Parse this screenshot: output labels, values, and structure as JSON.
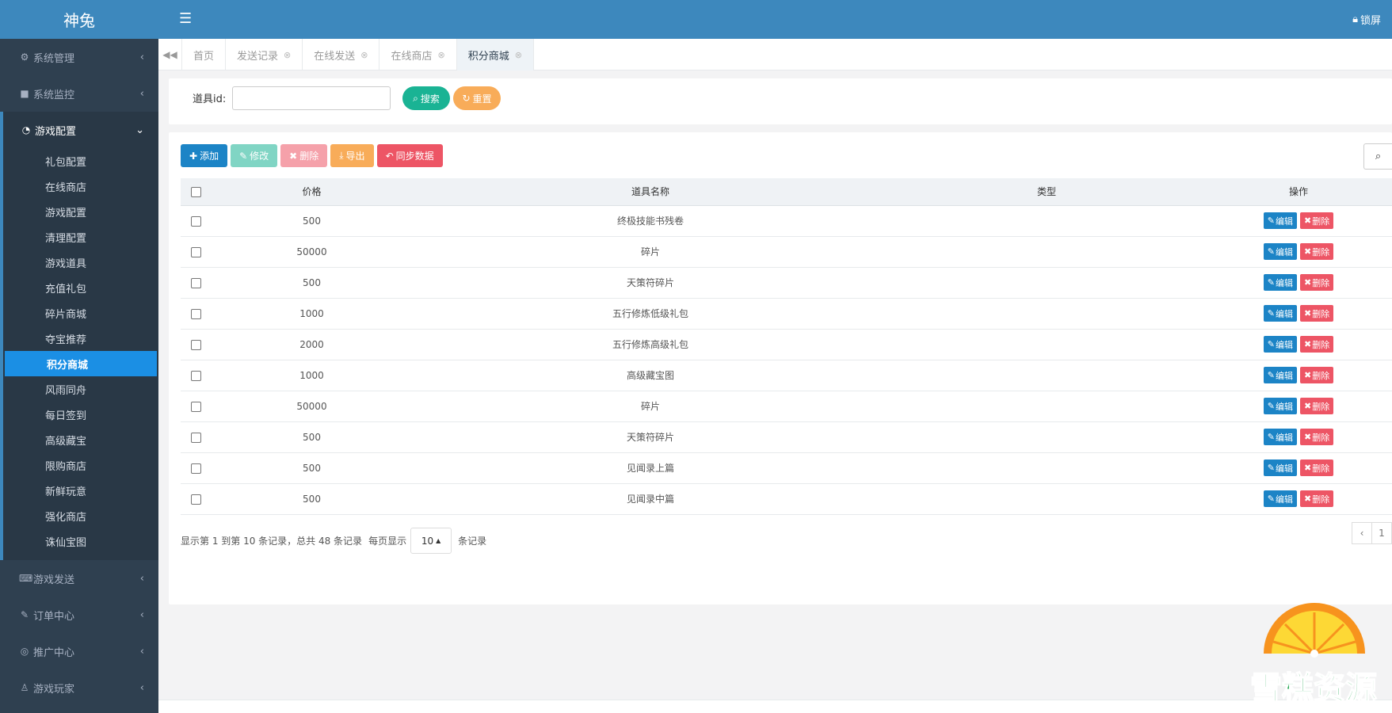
{
  "brand": "神兔",
  "topbar": {
    "lock_label": "锁屏"
  },
  "sidebar": {
    "items_top": [
      {
        "label": "系统管理"
      },
      {
        "label": "系统监控"
      }
    ],
    "group": {
      "label": "游戏配置",
      "children": [
        "礼包配置",
        "在线商店",
        "游戏配置",
        "清理配置",
        "游戏道具",
        "充值礼包",
        "碎片商城",
        "夺宝推荐",
        "积分商城",
        "风雨同舟",
        "每日签到",
        "高级藏宝",
        "限购商店",
        "新鲜玩意",
        "强化商店",
        "诛仙宝图"
      ],
      "active_index": 8
    },
    "items_bottom": [
      {
        "label": "游戏发送"
      },
      {
        "label": "订单中心"
      },
      {
        "label": "推广中心"
      },
      {
        "label": "游戏玩家"
      }
    ]
  },
  "tabs": [
    {
      "label": "首页",
      "closable": false
    },
    {
      "label": "发送记录",
      "closable": true
    },
    {
      "label": "在线发送",
      "closable": true
    },
    {
      "label": "在线商店",
      "closable": true
    },
    {
      "label": "积分商城",
      "closable": true,
      "active": true
    }
  ],
  "search": {
    "label": "道具id:",
    "value": "",
    "search_btn": "搜索",
    "reset_btn": "重置"
  },
  "toolbar": {
    "add": "添加",
    "edit": "修改",
    "delete": "删除",
    "export": "导出",
    "sync": "同步数据"
  },
  "table": {
    "headers": [
      "价格",
      "道具名称",
      "类型",
      "操作"
    ],
    "rows": [
      {
        "price": "500",
        "name": "终极技能书残卷",
        "type": ""
      },
      {
        "price": "50000",
        "name": "碎片",
        "type": ""
      },
      {
        "price": "500",
        "name": "天策符碎片",
        "type": ""
      },
      {
        "price": "1000",
        "name": "五行修炼低级礼包",
        "type": ""
      },
      {
        "price": "2000",
        "name": "五行修炼高级礼包",
        "type": ""
      },
      {
        "price": "1000",
        "name": "高级藏宝图",
        "type": ""
      },
      {
        "price": "50000",
        "name": "碎片",
        "type": ""
      },
      {
        "price": "500",
        "name": "天策符碎片",
        "type": ""
      },
      {
        "price": "500",
        "name": "见闻录上篇",
        "type": ""
      },
      {
        "price": "500",
        "name": "见闻录中篇",
        "type": ""
      }
    ],
    "op_edit": "编辑",
    "op_delete": "删除"
  },
  "footer": {
    "summary": "显示第 1 到第 10 条记录，总共 48 条记录",
    "per_page_prefix": "每页显示",
    "per_page_value": "10",
    "per_page_suffix": "条记录",
    "prev": "‹",
    "page": "1"
  },
  "watermark_text": "雪糕资源",
  "colors": {
    "header_blue": "#3d88bd",
    "sidebar_bg": "#2f4050",
    "active_item": "#1b8fe4",
    "primary": "#1c84c6",
    "success": "#1ab394",
    "warning": "#f8ac59",
    "danger": "#ed5565"
  }
}
